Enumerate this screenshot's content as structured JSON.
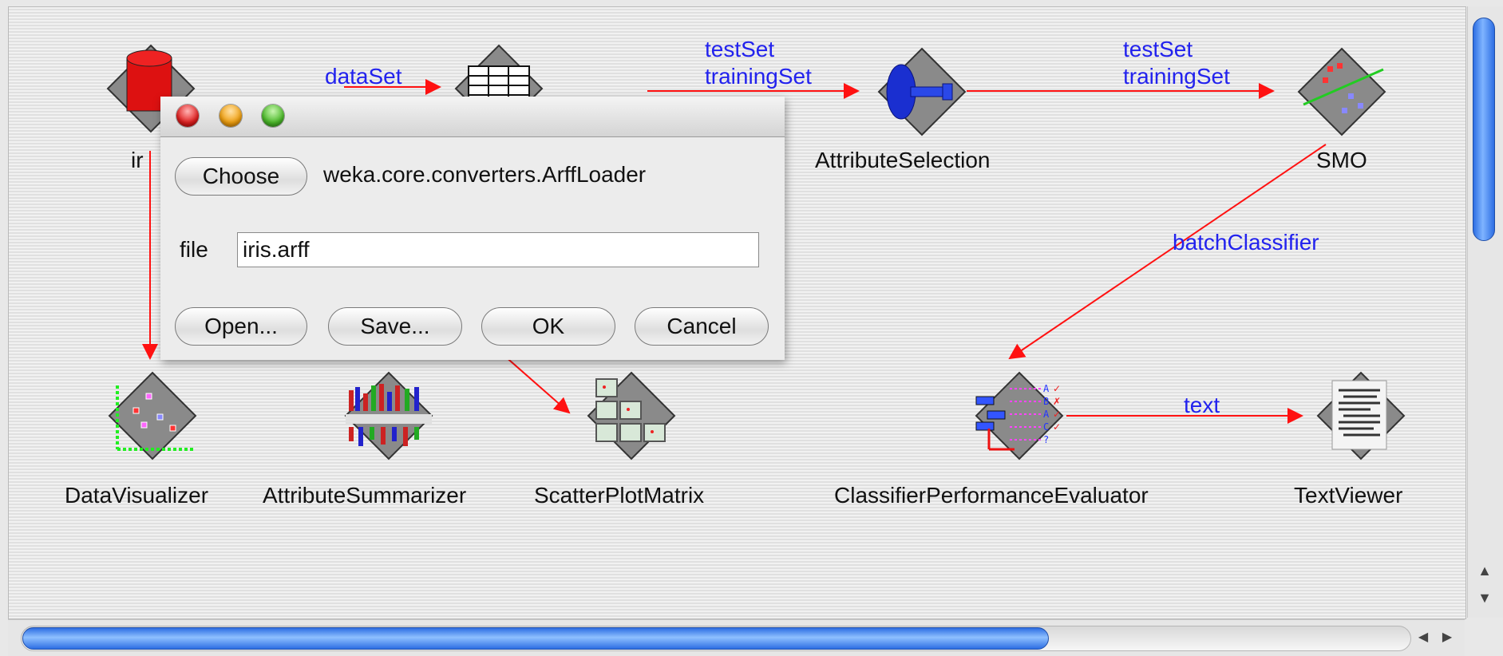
{
  "links": [
    {
      "label": "dataSet"
    },
    {
      "label": "testSet\ntrainingSet"
    },
    {
      "label": "testSet\ntrainingSet"
    },
    {
      "label": "batchClassifier"
    },
    {
      "label": "text"
    }
  ],
  "nodes": {
    "loader": {
      "label": "ir",
      "icon": "arff-loader-icon"
    },
    "class_assigner": {
      "label": "",
      "icon": "class-assigner-icon"
    },
    "attribute_selection": {
      "label": "AttributeSelection",
      "icon": "attribute-selection-icon"
    },
    "smo": {
      "label": "SMO",
      "icon": "smo-icon"
    },
    "data_visualizer": {
      "label": "DataVisualizer",
      "icon": "data-visualizer-icon"
    },
    "attribute_summarizer": {
      "label": "AttributeSummarizer",
      "icon": "attribute-summarizer-icon"
    },
    "scatter_plot_matrix": {
      "label": "ScatterPlotMatrix",
      "icon": "scatter-plot-matrix-icon"
    },
    "classifier_performance_evaluator": {
      "label": "ClassifierPerformanceEvaluator",
      "icon": "classifier-performance-evaluator-icon"
    },
    "text_viewer": {
      "label": "TextViewer",
      "icon": "text-viewer-icon"
    }
  },
  "dialog": {
    "choose_label": "Choose",
    "class_name": "weka.core.converters.ArffLoader",
    "file_label": "file",
    "file_value": "iris.arff",
    "open_label": "Open...",
    "save_label": "Save...",
    "ok_label": "OK",
    "cancel_label": "Cancel"
  },
  "colors": {
    "link": "#ff1111",
    "link_label": "#2222ee",
    "scroll_thumb": "#2d6ee3"
  }
}
